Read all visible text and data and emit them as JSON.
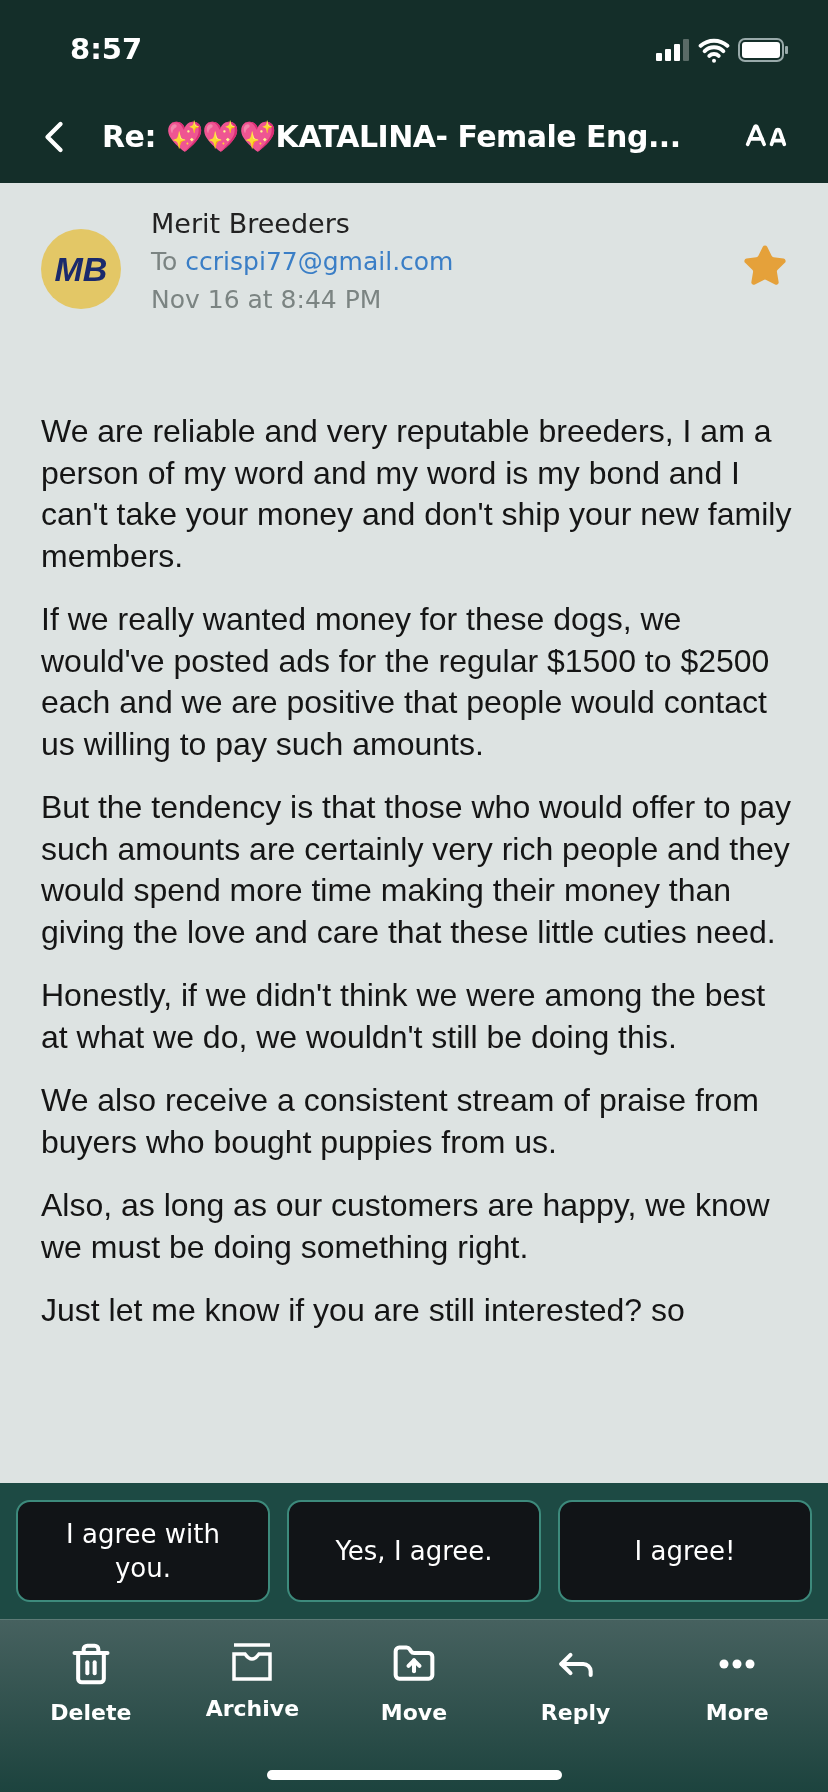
{
  "status_bar": {
    "time": "8:57"
  },
  "header": {
    "title": "Re: 💖💖💖KATALINA- Female Eng..."
  },
  "message": {
    "avatar_text": "MB",
    "sender": "Merit Breeders",
    "to_label": "To",
    "to_address": "ccrispi77@gmail.com",
    "date": "Nov 16 at 8:44 PM",
    "starred": true,
    "paragraphs": [
      "We are reliable and very reputable breeders, I am a person of my word and my word is my bond and I can't take your money and don't ship your new family members.",
      "If we really wanted money for these dogs, we would've posted ads for the regular $1500 to $2500 each and we are positive that people would contact us willing to pay such amounts.",
      "But the tendency is that those who would offer to pay such amounts are certainly very rich people and they would spend more time making their money than giving the love and care that these little cuties need.",
      "Honestly, if we didn't think we were among the best at what we do, we wouldn't still be doing this.",
      "We also receive a consistent stream of praise from buyers who bought puppies from us.",
      "Also, as long as our customers are happy, we know we must be doing something right.",
      "Just let me know if you are still interested? so"
    ]
  },
  "quick_replies": [
    "I agree with you.",
    "Yes, I agree.",
    "I agree!"
  ],
  "toolbar": [
    {
      "kind": "delete",
      "label": "Delete"
    },
    {
      "kind": "archive",
      "label": "Archive"
    },
    {
      "kind": "move",
      "label": "Move"
    },
    {
      "kind": "reply",
      "label": "Reply"
    },
    {
      "kind": "more",
      "label": "More"
    }
  ]
}
